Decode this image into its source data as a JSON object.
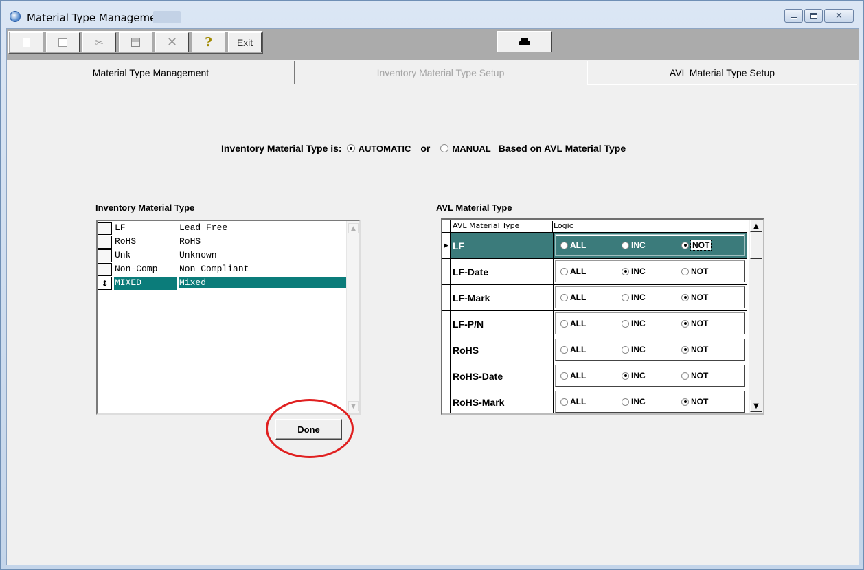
{
  "window": {
    "title": "Material Type Management"
  },
  "toolbar": {
    "buttons": [
      {
        "name": "new",
        "icon": "new-document-icon"
      },
      {
        "name": "edit",
        "icon": "edit-icon"
      },
      {
        "name": "cut",
        "icon": "scissors-icon"
      },
      {
        "name": "save",
        "icon": "save-icon"
      },
      {
        "name": "delete",
        "icon": "delete-x-icon"
      },
      {
        "name": "help",
        "icon": "help-question-icon"
      }
    ],
    "exit_label_pre": "E",
    "exit_label_u": "x",
    "exit_label_post": "it",
    "print_icon": "printer-icon"
  },
  "tabs": [
    {
      "label": "Material Type Management",
      "state": "active"
    },
    {
      "label": "Inventory Material Type Setup",
      "state": "disabled"
    },
    {
      "label": "AVL Material Type Setup",
      "state": "normal"
    }
  ],
  "mode": {
    "prefix": "Inventory Material Type is:",
    "automatic": "AUTOMATIC",
    "or": "or",
    "manual": "MANUAL",
    "suffix": "Based on AVL Material Type",
    "selected": "AUTOMATIC"
  },
  "inventory": {
    "heading": "Inventory Material Type",
    "rows": [
      {
        "code": "LF",
        "desc": "Lead Free",
        "selected": false
      },
      {
        "code": "RoHS",
        "desc": "RoHS",
        "selected": false
      },
      {
        "code": "Unk",
        "desc": "Unknown",
        "selected": false
      },
      {
        "code": "Non-Comp",
        "desc": "Non Compliant",
        "selected": false
      },
      {
        "code": "MIXED",
        "desc": "Mixed",
        "selected": true
      }
    ],
    "done_label": "Done"
  },
  "avl": {
    "heading": "AVL Material Type",
    "col_type": "AVL Material Type",
    "col_logic": "Logic",
    "options": [
      "ALL",
      "INC",
      "NOT"
    ],
    "rows": [
      {
        "type": "LF",
        "logic": "NOT",
        "current": true
      },
      {
        "type": "LF-Date",
        "logic": "INC",
        "current": false
      },
      {
        "type": "LF-Mark",
        "logic": "NOT",
        "current": false
      },
      {
        "type": "LF-P/N",
        "logic": "NOT",
        "current": false
      },
      {
        "type": "RoHS",
        "logic": "NOT",
        "current": false
      },
      {
        "type": "RoHS-Date",
        "logic": "INC",
        "current": false
      },
      {
        "type": "RoHS-Mark",
        "logic": "NOT",
        "current": false
      }
    ]
  },
  "colors": {
    "selection": "#0b7c7a",
    "current_row": "#3b7b7b",
    "annotation_circle": "#e02020"
  }
}
